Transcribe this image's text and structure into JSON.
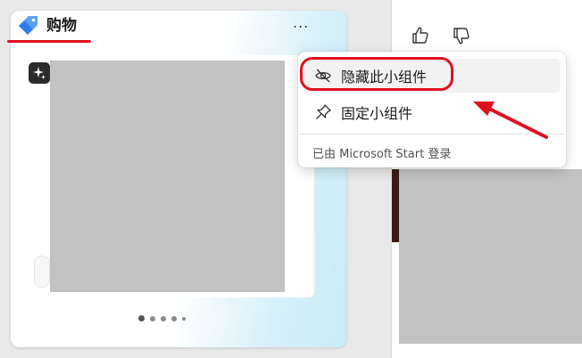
{
  "widget": {
    "title": "购物",
    "icon": "price-tag-icon",
    "more_label": "...",
    "badge_icon": "sparkle-icon",
    "carousel": {
      "pages": 5,
      "active_index": 0
    }
  },
  "right_column": {
    "like_icon": "thumbs-up-icon",
    "dislike_icon": "thumbs-down-icon"
  },
  "context_menu": {
    "items": [
      {
        "label": "隐藏此小组件",
        "icon": "eye-off-icon",
        "highlighted": true
      },
      {
        "label": "固定小组件",
        "icon": "pin-icon",
        "highlighted": false
      }
    ],
    "footer": "已由 Microsoft Start 登录"
  },
  "colors": {
    "annotation": "#e0101e",
    "tag_blue": "#2b7de9"
  }
}
